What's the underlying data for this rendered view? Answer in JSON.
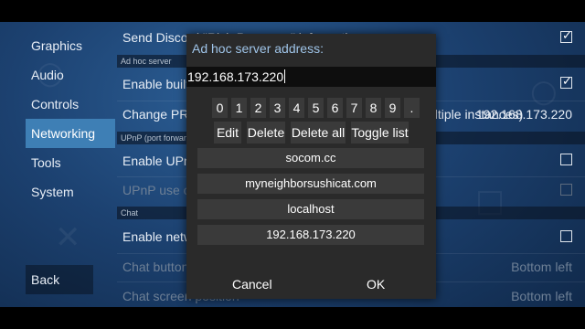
{
  "sidebar": {
    "items": [
      {
        "label": "Graphics",
        "active": false
      },
      {
        "label": "Audio",
        "active": false
      },
      {
        "label": "Controls",
        "active": false
      },
      {
        "label": "Networking",
        "active": true
      },
      {
        "label": "Tools",
        "active": false
      },
      {
        "label": "System",
        "active": false
      }
    ],
    "back_label": "Back"
  },
  "settings": {
    "discord_label": "Send Discord \"Rich Presence\" information",
    "section_adhoc": "Ad hoc server",
    "enable_builtin_label": "Enable built-in PRO Adhoc Server",
    "change_pro_label": "Change PRO Adhoc Server IP Address (localhost = multiple instances)",
    "change_pro_value": "192.168.173.220",
    "section_upnp": "UPnP (port forwarding)",
    "enable_upnp_label": "Enable UPnP (need a few seconds to detect)",
    "upnp_original_label": "UPnP use original port",
    "section_chat": "Chat",
    "enable_chat_label": "Enable network chat",
    "chat_button_label": "Chat button position",
    "chat_button_value": "Bottom left",
    "chat_screen_label": "Chat screen position",
    "chat_screen_value": "Bottom left"
  },
  "dialog": {
    "title": "Ad hoc server address:",
    "input_value": "192.168.173.220",
    "digits": [
      "0",
      "1",
      "2",
      "3",
      "4",
      "5",
      "6",
      "7",
      "8",
      "9",
      "."
    ],
    "edit_label": "Edit",
    "delete_label": "Delete",
    "delete_all_label": "Delete all",
    "toggle_list_label": "Toggle list",
    "servers": [
      "socom.cc",
      "myneighborsushicat.com",
      "localhost",
      "192.168.173.220"
    ],
    "cancel_label": "Cancel",
    "ok_label": "OK"
  },
  "colors": {
    "accent_active": "#3e7fb5",
    "dialog_bg": "#2a2a2a",
    "dialog_title": "#9fc4e8"
  }
}
